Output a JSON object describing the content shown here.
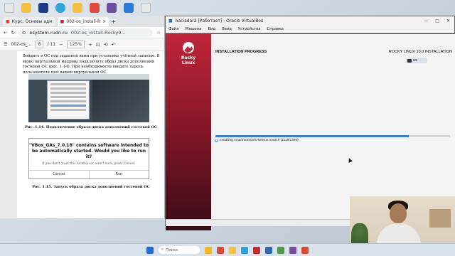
{
  "browser": {
    "tabs": [
      {
        "label": "Курс: Основы адм"
      },
      {
        "label": "002-os_install-R"
      }
    ],
    "address": "esystem.rudn.ru",
    "address_tail": "002-os_install-Rocky9...",
    "pdf_name": "002-os_...",
    "page_current": "8",
    "page_total": "/ 11",
    "zoom": "125%"
  },
  "document": {
    "paragraph": "Войдите в ОС под заданной вами при установке учётной записью. В меню виртуальной машины подключите образ диска дополнений гостевой ОС (рис. 1.14). При необходимости введите пароль пользователя root вашей виртуальной ОС.",
    "fig1_caption": "Рис. 1.14. Подключение образа диска дополнений гостевой ОС",
    "dialog_question": "\"VBox_GAs_7.0.18\" contains software intended to be automatically started. Would you like to run it?",
    "dialog_sub": "If you don't trust this location or aren't sure, press Cancel.",
    "dialog_cancel": "Cancel",
    "dialog_run": "Run",
    "fig2_caption": "Рис. 1.15. Запуск образа диска дополнений гостевой ОС"
  },
  "vbox": {
    "title": "haciadar2 [Работает] - Oracle VirtualBox",
    "menu": [
      "Файл",
      "Машина",
      "Вид",
      "Ввод",
      "Устройства",
      "Справка"
    ],
    "logo_text": "Rocky\nLinux",
    "progress_title": "INSTALLATION PROGRESS",
    "right_title": "ROCKY LINUX 10.0 INSTALLATION",
    "keyboard": "us",
    "status": "Installing smartmontools-selinux.noarch (1118/1356)",
    "progress_fraction": 0.825
  },
  "taskbar": {
    "search_label": "Поиск"
  },
  "colors": {
    "rocky_red": "#c0253a",
    "progress_blue": "#3b7fd4"
  }
}
